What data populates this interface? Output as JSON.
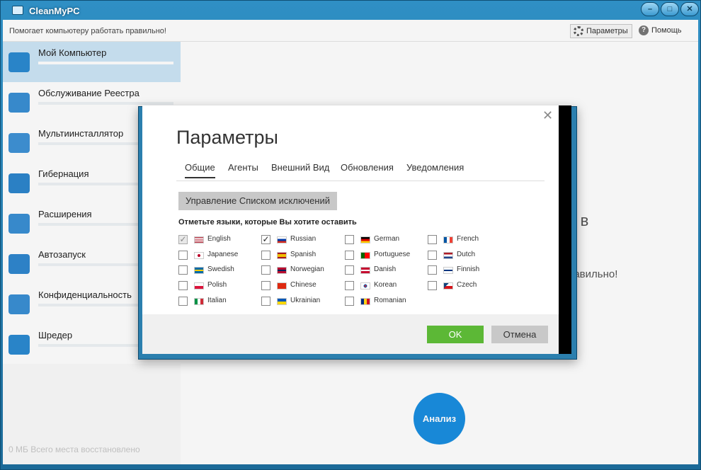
{
  "window": {
    "title": "CleanMyPC",
    "buttons": {
      "minimize": "–",
      "maximize": "□",
      "close": "✕"
    }
  },
  "topbar": {
    "tagline": "Помогает компьютеру работать правильно!",
    "params_label": "Параметры",
    "help_label": "Помощь"
  },
  "sidebar": {
    "items": [
      {
        "label": "Мой Компьютер",
        "icon": "monitor-icon",
        "active": true
      },
      {
        "label": "Обслуживание Реестра",
        "icon": "cubes-icon"
      },
      {
        "label": "Мультиинсталлятор",
        "icon": "box-icon"
      },
      {
        "label": "Гибернация",
        "icon": "sleep-monitor-icon"
      },
      {
        "label": "Расширения",
        "icon": "puzzle-icon"
      },
      {
        "label": "Автозапуск",
        "icon": "paper-plane-icon"
      },
      {
        "label": "Конфиденциальность",
        "icon": "shield-icon"
      },
      {
        "label": "Шредер",
        "icon": "shredder-icon"
      }
    ],
    "recovered": "0 МБ Всего места восстановлено"
  },
  "main": {
    "headline_fragment": "ь в",
    "sub_fragment": "равильно!",
    "analyze_label": "Анализ"
  },
  "dialog": {
    "title": "Параметры",
    "close": "✕",
    "tabs": [
      "Общие",
      "Агенты",
      "Внешний Вид",
      "Обновления",
      "Уведомления"
    ],
    "exclusions_button": "Управление Списком исключений",
    "languages_caption": "Отметьте языки, которые Вы хотите оставить",
    "languages": [
      {
        "name": "English",
        "state": "checked-disabled",
        "flag": "us"
      },
      {
        "name": "Russian",
        "state": "checked",
        "flag": "ru"
      },
      {
        "name": "German",
        "state": "unchecked",
        "flag": "de"
      },
      {
        "name": "French",
        "state": "unchecked",
        "flag": "fr"
      },
      {
        "name": "Japanese",
        "state": "unchecked",
        "flag": "jp"
      },
      {
        "name": "Spanish",
        "state": "unchecked",
        "flag": "es"
      },
      {
        "name": "Portuguese",
        "state": "unchecked",
        "flag": "pt"
      },
      {
        "name": "Dutch",
        "state": "unchecked",
        "flag": "nl"
      },
      {
        "name": "Swedish",
        "state": "unchecked",
        "flag": "se"
      },
      {
        "name": "Norwegian",
        "state": "unchecked",
        "flag": "no"
      },
      {
        "name": "Danish",
        "state": "unchecked",
        "flag": "dk"
      },
      {
        "name": "Finnish",
        "state": "unchecked",
        "flag": "fi"
      },
      {
        "name": "Polish",
        "state": "unchecked",
        "flag": "pl"
      },
      {
        "name": "Chinese",
        "state": "unchecked",
        "flag": "cn"
      },
      {
        "name": "Korean",
        "state": "unchecked",
        "flag": "kr"
      },
      {
        "name": "Czech",
        "state": "unchecked",
        "flag": "cz"
      },
      {
        "name": "Italian",
        "state": "unchecked",
        "flag": "it"
      },
      {
        "name": "Ukrainian",
        "state": "unchecked",
        "flag": "ua"
      },
      {
        "name": "Romanian",
        "state": "unchecked",
        "flag": "ro"
      }
    ],
    "ok_label": "OK",
    "cancel_label": "Отмена"
  },
  "colors": {
    "frame_blue": "#2b7fae",
    "active_item": "#cde5f6",
    "ok_green": "#5cb836",
    "analyze_blue": "#1a8ee0"
  }
}
